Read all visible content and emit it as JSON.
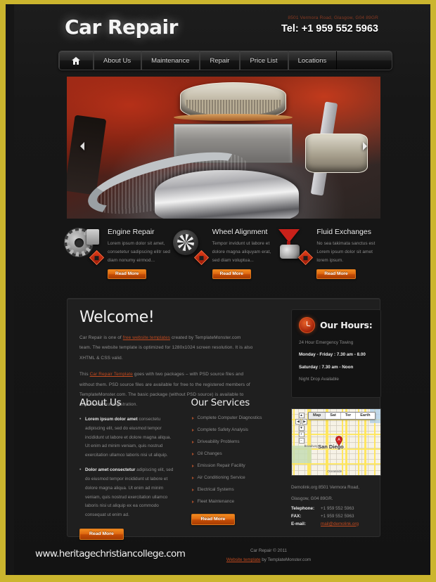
{
  "header": {
    "logo": "Car Repair",
    "address": "8501 Vermora Road, Glasgow, G04 89GR",
    "phone": "Tel: +1 959 552 5963"
  },
  "nav": {
    "home_icon": "home-icon",
    "items": [
      {
        "label": "About Us"
      },
      {
        "label": "Maintenance"
      },
      {
        "label": "Repair"
      },
      {
        "label": "Price List"
      },
      {
        "label": "Locations"
      }
    ]
  },
  "slider": {
    "prev_icon": "chevron-left-icon",
    "next_icon": "chevron-right-icon",
    "image_alt": "car-engine-photo"
  },
  "services": [
    {
      "icon": "gear-icon",
      "title": "Engine Repair",
      "text": "Lorem ipsum dolor sit amet, consetetur sadipscing elitr sed diam nonumy eirmod...",
      "button": "Read More"
    },
    {
      "icon": "wheel-icon",
      "title": "Wheel Alignment",
      "text": "Tempor invidunt ut labore et dolore magna aliquyam erat, sed diam voluptua...",
      "button": "Read More"
    },
    {
      "icon": "funnel-icon",
      "title": "Fluid Exchanges",
      "text": "No sea takimata sanctus est Lorem ipsum dolor sit amet lorem ipsum.",
      "button": "Read More"
    }
  ],
  "welcome": {
    "title": "Welcome!",
    "p1_a": "Car Repair is one of ",
    "p1_link": "free website templates",
    "p1_b": " created by TemplateMonster.com team. The website template is optimized for 1280x1024 screen resolution. It is also XHTML & CSS valid.",
    "p2_a": "This ",
    "p2_link": "Car Repair Template",
    "p2_b": " goes with two packages – with PSD source files and without them. PSD source files are available for free to the registered members of TemplateMonster.com. The basic package (without PSD source) is available to anyone without registration."
  },
  "hours": {
    "icon": "clock-icon",
    "title": "Our Hours:",
    "lines": [
      {
        "text": "24 Hour Emergency Towing",
        "bold": false
      },
      {
        "text": "Monday - Friday : 7.30 am - 8.00",
        "bold": true
      },
      {
        "text": "Saturday : 7.30 am - Noon",
        "bold": true
      },
      {
        "text": "Night Drop Available",
        "bold": false
      }
    ]
  },
  "about": {
    "title": "About Us",
    "items": [
      {
        "lead": "Lorem ipsum dolor amet",
        "rest": " consectetu adipiscing elit, sed do eiusmod tempor incididunt ut labore et dolore magna aliqua. Ut enim ad minim veniam, quis nostrud exercitation ullamco laboris nisi ut aliquip."
      },
      {
        "lead": "Dolor amet consectetur",
        "rest": " adipiscing elit, sed do eiusmod tempor incididunt ut labore et dolore magna aliqua. Ut enim ad minim veniam, quis nostrud exercitation ullamco laboris nisi ut aliquip ex ea commodo consequat ut enim ad."
      }
    ],
    "button": "Read More"
  },
  "our_services": {
    "title": "Our Services",
    "items": [
      "Complete Computer Diagnostics",
      "Complete Safety Analysis",
      "Driveability Problems",
      "Oil Changes",
      "Emission Repair Facility",
      "Air Conditioning Service",
      "Electrical Systems",
      "Fleet Maintenance"
    ],
    "button": "Read More"
  },
  "map": {
    "tabs": [
      "Map",
      "Sat",
      "Ter",
      "Earth"
    ],
    "active_tab": "Map",
    "city_label": "San Diego",
    "label_broadway": "Broadway",
    "label_oceanbg": "Oceanside",
    "marker": "A",
    "zoom_in": "+",
    "zoom_out": "−"
  },
  "contact": {
    "address_line1": "Demolink.org 8501 Vermora Road,",
    "address_line2": "Glasgow, G04 89GR.",
    "telephone_label": "Telephone:",
    "telephone_value": "+1 959 552 5963",
    "fax_label": "FAX:",
    "fax_value": "+1 959 552 5963",
    "email_label": "E-mail:",
    "email_value": "mail@demolink.org"
  },
  "footer": {
    "site": "www.heritagechristiancollege.com",
    "copyright": "Car Repair © 2011",
    "credit_link": "Website template",
    "credit_rest": " by TemplateMonster.com"
  }
}
